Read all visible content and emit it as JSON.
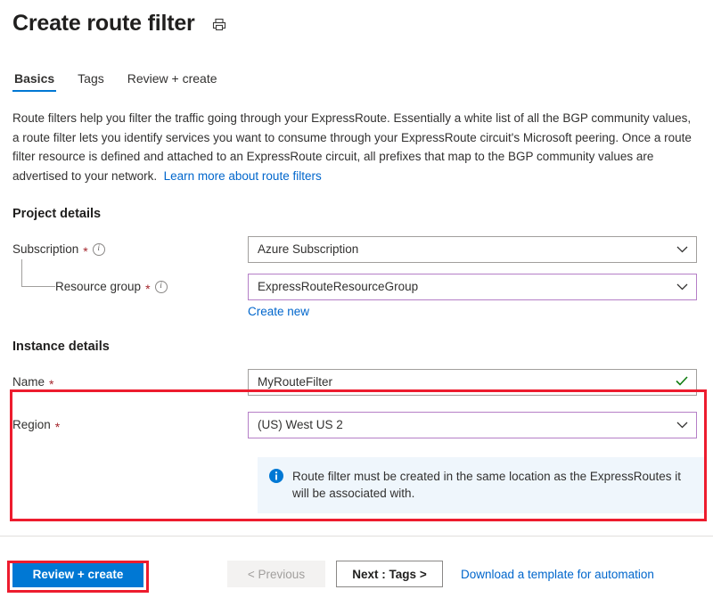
{
  "header": {
    "title": "Create route filter",
    "print_icon": "printer-icon"
  },
  "tabs": [
    {
      "label": "Basics",
      "active": true
    },
    {
      "label": "Tags",
      "active": false
    },
    {
      "label": "Review + create",
      "active": false
    }
  ],
  "intro": {
    "text": "Route filters help you filter the traffic going through your ExpressRoute. Essentially a white list of all the BGP community values, a route filter lets you identify services you want to consume through your ExpressRoute circuit's Microsoft peering. Once a route filter resource is defined and attached to an ExpressRoute circuit, all prefixes that map to the BGP community values are advertised to your network.",
    "link_label": "Learn more about route filters"
  },
  "project_details": {
    "section_title": "Project details",
    "subscription": {
      "label": "Subscription",
      "required_marker": "*",
      "info_icon": "info-icon",
      "value": "Azure Subscription"
    },
    "resource_group": {
      "label": "Resource group",
      "required_marker": "*",
      "info_icon": "info-icon",
      "value": "ExpressRouteResourceGroup",
      "create_new_label": "Create new"
    }
  },
  "instance_details": {
    "section_title": "Instance details",
    "name": {
      "label": "Name",
      "required_marker": "*",
      "value": "MyRouteFilter",
      "valid_icon": "check-icon"
    },
    "region": {
      "label": "Region",
      "required_marker": "*",
      "value": "(US) West US 2"
    }
  },
  "info_banner": {
    "icon": "info-filled-icon",
    "text": "Route filter must be created in the same location as the ExpressRoutes it will be associated with."
  },
  "footer": {
    "review_create_label": "Review + create",
    "previous_label": "< Previous",
    "next_label": "Next : Tags >",
    "download_template_label": "Download a template for automation"
  },
  "colors": {
    "accent_blue": "#0078d4",
    "link_blue": "#0066cc",
    "required_red": "#a4262c",
    "highlight_red": "#ed1c2e",
    "field_accent_purple": "#b57fc7",
    "banner_bg": "#eff6fc",
    "valid_green": "#107c10"
  }
}
